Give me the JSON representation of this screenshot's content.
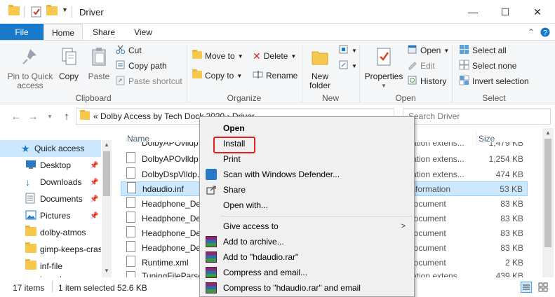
{
  "window": {
    "title": "Driver",
    "minimize": "—",
    "maximize": "☐",
    "close": "✕"
  },
  "tabs": {
    "file": "File",
    "home": "Home",
    "share": "Share",
    "view": "View"
  },
  "ribbon": {
    "clipboard": {
      "pin": "Pin to Quick access",
      "copy": "Copy",
      "paste": "Paste",
      "cut": "Cut",
      "copy_path": "Copy path",
      "paste_shortcut": "Paste shortcut",
      "label": "Clipboard"
    },
    "organize": {
      "move_to": "Move to",
      "copy_to": "Copy to",
      "delete": "Delete",
      "rename": "Rename",
      "label": "Organize"
    },
    "new": {
      "new_folder": "New folder",
      "label": "New"
    },
    "open": {
      "properties": "Properties",
      "open": "Open",
      "edit": "Edit",
      "history": "History",
      "label": "Open"
    },
    "select": {
      "select_all": "Select all",
      "select_none": "Select none",
      "invert": "Invert selection",
      "label": "Select"
    }
  },
  "address": {
    "crumbs": "«  Dolby Access by Tech Dock 2020  ›  Driver",
    "search_placeholder": "Search Driver"
  },
  "nav": {
    "items": [
      {
        "label": "Quick access"
      },
      {
        "label": "Desktop"
      },
      {
        "label": "Downloads"
      },
      {
        "label": "Documents"
      },
      {
        "label": "Pictures"
      },
      {
        "label": "dolby-atmos"
      },
      {
        "label": "gimp-keeps-cras"
      },
      {
        "label": "inf-file"
      },
      {
        "label": "isunshare"
      }
    ]
  },
  "columns": {
    "name": "Name",
    "size": "Size"
  },
  "files": [
    {
      "name": "DolbyAPOvlldp",
      "type": "cation extens...",
      "size": "1,479 KB"
    },
    {
      "name": "DolbyAPOvlldp.",
      "type": "cation extens...",
      "size": "1,254 KB"
    },
    {
      "name": "DolbyDspVlldp.",
      "type": "cation extens...",
      "size": "474 KB"
    },
    {
      "name": "hdaudio.inf",
      "type": "Information",
      "size": "53 KB"
    },
    {
      "name": "Headphone_De",
      "type": "Document",
      "size": "83 KB"
    },
    {
      "name": "Headphone_De",
      "type": "Document",
      "size": "83 KB"
    },
    {
      "name": "Headphone_De",
      "type": "Document",
      "size": "83 KB"
    },
    {
      "name": "Headphone_De",
      "type": "Document",
      "size": "83 KB"
    },
    {
      "name": "Runtime.xml",
      "type": "Document",
      "size": "2 KB"
    },
    {
      "name": "TuningFileParse",
      "type": "cation extens...",
      "size": "439 KB"
    }
  ],
  "status": {
    "count": "17 items",
    "selected": "1 item selected  52.6 KB"
  },
  "context_menu": {
    "open": "Open",
    "install": "Install",
    "print": "Print",
    "scan": "Scan with Windows Defender...",
    "share": "Share",
    "open_with": "Open with...",
    "give_access": "Give access to",
    "add_archive": "Add to archive...",
    "add_rar": "Add to \"hdaudio.rar\"",
    "compress_email": "Compress and email...",
    "compress_rar_email": "Compress to \"hdaudio.rar\" and email"
  }
}
